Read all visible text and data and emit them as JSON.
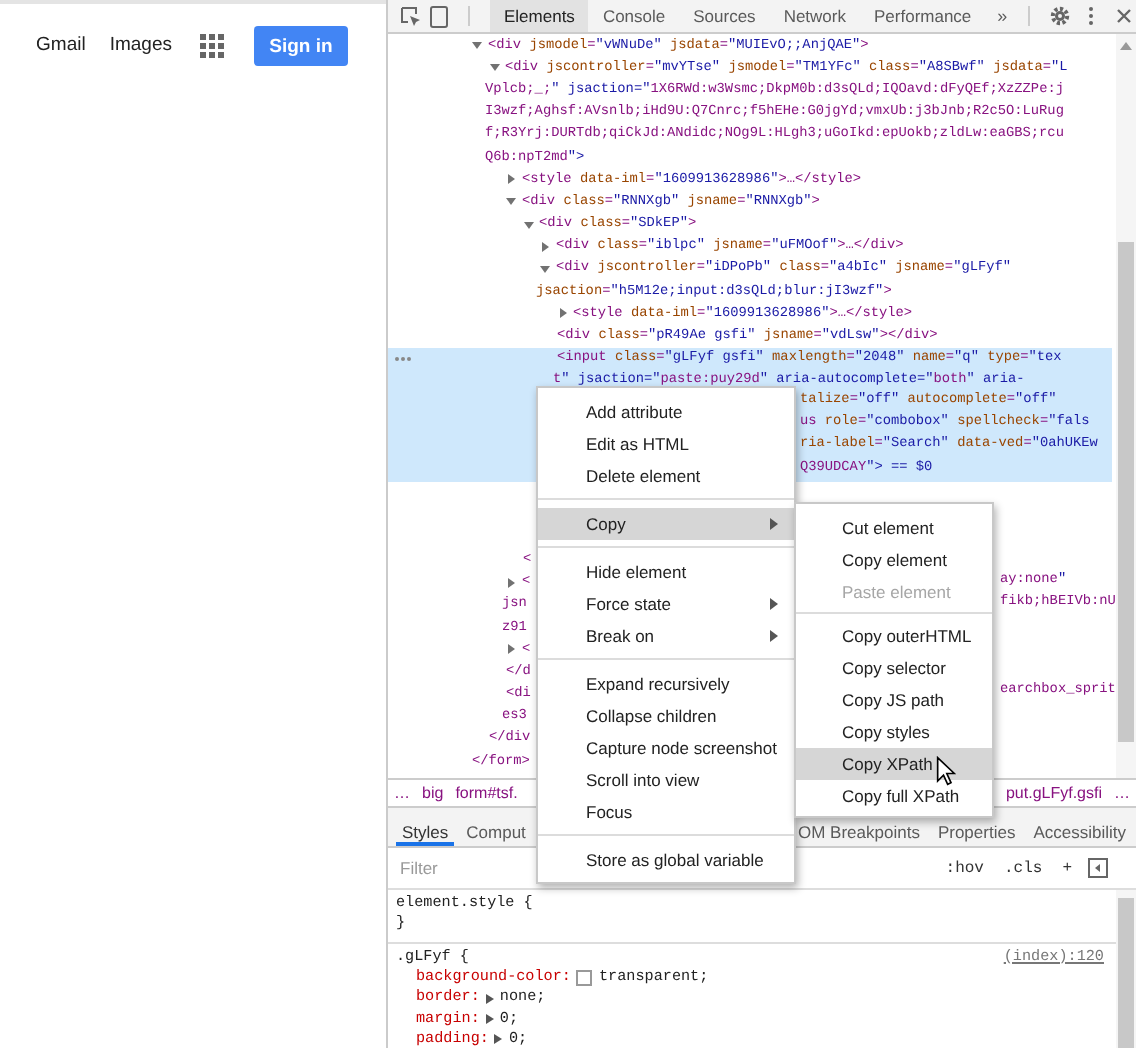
{
  "page": {
    "links": [
      "Gmail",
      "Images"
    ],
    "sign_in": "Sign in"
  },
  "devtools": {
    "tabs": [
      {
        "label": "Elements",
        "selected": true
      },
      {
        "label": "Console",
        "selected": false
      },
      {
        "label": "Sources",
        "selected": false
      },
      {
        "label": "Network",
        "selected": false
      },
      {
        "label": "Performance",
        "selected": false
      }
    ],
    "more_tabs": "»",
    "dom_tree": [
      {
        "selected": false,
        "expanded": true,
        "lines": [
          {
            "text": "<div jsmodel=\"vWNuDe\" jsdata=\"MUIEvO;;AnjQAE\">"
          }
        ],
        "children": [
          {
            "selected": false,
            "expanded": true,
            "lines": [
              {
                "text": "<div jscontroller=\"mvYTse\" jsmodel=\"TM1YFc\" class=\"A8SBwf\" jsdata=\"L"
              },
              {
                "text": "Vplcb;_;\" jsaction=\"1X6RWd:w3Wsmc;DkpM0b:d3sQLd;IQOavd:dFyQEf;XzZZPe:j"
              },
              {
                "text": "I3wzf;Aghsf:AVsnlb;iHd9U:Q7Cnrc;f5hEHe:G0jgYd;vmxUb:j3bJnb;R2c5O:LuRug"
              },
              {
                "text": "f;R3Yrj:DURTdb;qiCkJd:ANdidc;NOg9L:HLgh3;uGoIkd:epUokb;zldLw:eaGBS;rcu"
              },
              {
                "text": "Q6b:npT2md\">"
              }
            ],
            "children": [
              {
                "selected": false,
                "expanded": false,
                "lines": [
                  {
                    "text": "<style data-iml=\"1609913628986\">…</style>"
                  }
                ]
              },
              {
                "selected": false,
                "expanded": true,
                "lines": [
                  {
                    "text": "<div class=\"RNNXgb\" jsname=\"RNNXgb\">"
                  }
                ],
                "children": [
                  {
                    "selected": false,
                    "expanded": true,
                    "lines": [
                      {
                        "text": "<div class=\"SDkEP\">"
                      }
                    ],
                    "children": [
                      {
                        "selected": false,
                        "expanded": false,
                        "lines": [
                          {
                            "text": "<div class=\"iblpc\" jsname=\"uFMOof\">…</div>"
                          }
                        ]
                      },
                      {
                        "selected": false,
                        "expanded": true,
                        "lines": [
                          {
                            "text": "<div jscontroller=\"iDPoPb\" class=\"a4bIc\" jsname=\"gLFyf\""
                          },
                          {
                            "text": "jsaction=\"h5M12e;input:d3sQLd;blur:jI3wzf\">"
                          }
                        ],
                        "children": [
                          {
                            "selected": false,
                            "expanded": false,
                            "lines": [
                              {
                                "text": "<style data-iml=\"1609913628986\">…</style>"
                              }
                            ]
                          },
                          {
                            "selected": false,
                            "lines": [
                              {
                                "text": "<div class=\"pR49Ae gsfi\" jsname=\"vdLsw\"></div>"
                              }
                            ]
                          },
                          {
                            "selected": true,
                            "lines": [
                              {
                                "text": "<input class=\"gLFyf gsfi\" maxlength=\"2048\" name=\"q\" type=\"tex"
                              },
                              {
                                "text": "t\" jsaction=\"paste:puy29d\" aria-autocomplete=\"both\" aria-"
                              },
                              {
                                "tail": "talize=\"off\" autocomplete=\"off\""
                              },
                              {
                                "tail": "us role=\"combobox\" spellcheck=\"fals"
                              },
                              {
                                "tail": "ria-label=\"Search\" data-ved=\"0ahUKEw"
                              },
                              {
                                "tail": "Q39UDCAY\"> == $0"
                              }
                            ]
                          }
                        ]
                      }
                    ]
                  },
                  {
                    "selected": false,
                    "lines": [
                      {
                        "text": "<"
                      }
                    ]
                  }
                ]
              },
              {
                "selected": false,
                "expanded": false,
                "lines": [
                  {
                    "text": "<",
                    "tail": "ay:none\""
                  },
                  {
                    "text": "jsn",
                    "tail": "fikb;hBEIVb:nU"
                  },
                  {
                    "text": "z91"
                  }
                ]
              },
              {
                "selected": false,
                "expanded": false,
                "lines": [
                  {
                    "text": "<"
                  }
                ]
              },
              {
                "selected": false,
                "lines": [
                  {
                    "text": "</d"
                  }
                ]
              },
              {
                "selected": false,
                "lines": [
                  {
                    "text": "<di",
                    "tail": "earchbox_sprit"
                  },
                  {
                    "text": "es3"
                  }
                ]
              }
            ]
          },
          {
            "selected": false,
            "lines": [
              {
                "text": "</div"
              }
            ]
          }
        ]
      },
      {
        "selected": false,
        "lines": [
          {
            "text": "</form>"
          }
        ]
      }
    ],
    "breadcrumbs": {
      "left": [
        "…",
        "big",
        "form#tsf."
      ],
      "right": [
        "put.gLFyf.gsfi",
        "…"
      ]
    },
    "sidebar_tabs_left": [
      {
        "label": "Styles",
        "selected": true
      },
      {
        "label": "Comput",
        "selected": false
      }
    ],
    "sidebar_tabs_right": [
      {
        "label": "OM Breakpoints",
        "selected": false
      },
      {
        "label": "Properties",
        "selected": false
      },
      {
        "label": "Accessibility",
        "selected": false
      }
    ],
    "filter": {
      "placeholder": "Filter"
    },
    "filter_buttons": [
      ":hov",
      ".cls",
      "+"
    ],
    "style_rules": [
      {
        "selector": "element.style {",
        "closing": "}"
      },
      {
        "selector": ".gLFyf {",
        "source": "(index):120",
        "properties": [
          {
            "kind": "color",
            "name": "background-color:",
            "value": "transparent;"
          },
          {
            "kind": "shorthand",
            "name": "border:",
            "value": "none;"
          },
          {
            "kind": "shorthand",
            "name": "margin:",
            "value": "0;"
          },
          {
            "kind": "shorthand",
            "name": "padding:",
            "value": "0;"
          }
        ]
      }
    ]
  },
  "context_menu": [
    {
      "kind": "item",
      "label": "Add attribute",
      "selected": false,
      "disabled": false,
      "submenu": false
    },
    {
      "kind": "item",
      "label": "Edit as HTML",
      "selected": false,
      "disabled": false,
      "submenu": false
    },
    {
      "kind": "item",
      "label": "Delete element",
      "selected": false,
      "disabled": false,
      "submenu": false
    },
    {
      "kind": "separator"
    },
    {
      "kind": "item",
      "label": "Copy",
      "selected": true,
      "disabled": false,
      "submenu": true
    },
    {
      "kind": "separator"
    },
    {
      "kind": "item",
      "label": "Hide element",
      "selected": false,
      "disabled": false,
      "submenu": false
    },
    {
      "kind": "item",
      "label": "Force state",
      "selected": false,
      "disabled": false,
      "submenu": true
    },
    {
      "kind": "item",
      "label": "Break on",
      "selected": false,
      "disabled": false,
      "submenu": true
    },
    {
      "kind": "separator"
    },
    {
      "kind": "item",
      "label": "Expand recursively",
      "selected": false,
      "disabled": false,
      "submenu": false
    },
    {
      "kind": "item",
      "label": "Collapse children",
      "selected": false,
      "disabled": false,
      "submenu": false
    },
    {
      "kind": "item",
      "label": "Capture node screenshot",
      "selected": false,
      "disabled": false,
      "submenu": false
    },
    {
      "kind": "item",
      "label": "Scroll into view",
      "selected": false,
      "disabled": false,
      "submenu": false
    },
    {
      "kind": "item",
      "label": "Focus",
      "selected": false,
      "disabled": false,
      "submenu": false
    },
    {
      "kind": "separator"
    },
    {
      "kind": "item",
      "label": "Store as global variable",
      "selected": false,
      "disabled": false,
      "submenu": false
    }
  ],
  "copy_submenu": [
    {
      "kind": "item",
      "label": "Cut element",
      "selected": false,
      "disabled": false,
      "submenu": false
    },
    {
      "kind": "item",
      "label": "Copy element",
      "selected": false,
      "disabled": false,
      "submenu": false
    },
    {
      "kind": "item",
      "label": "Paste element",
      "selected": false,
      "disabled": true,
      "submenu": false
    },
    {
      "kind": "separator"
    },
    {
      "kind": "item",
      "label": "Copy outerHTML",
      "selected": false,
      "disabled": false,
      "submenu": false
    },
    {
      "kind": "item",
      "label": "Copy selector",
      "selected": false,
      "disabled": false,
      "submenu": false
    },
    {
      "kind": "item",
      "label": "Copy JS path",
      "selected": false,
      "disabled": false,
      "submenu": false
    },
    {
      "kind": "item",
      "label": "Copy styles",
      "selected": false,
      "disabled": false,
      "submenu": false
    },
    {
      "kind": "item",
      "label": "Copy XPath",
      "selected": true,
      "disabled": false,
      "submenu": false
    },
    {
      "kind": "item",
      "label": "Copy full XPath",
      "selected": false,
      "disabled": false,
      "submenu": false
    }
  ]
}
